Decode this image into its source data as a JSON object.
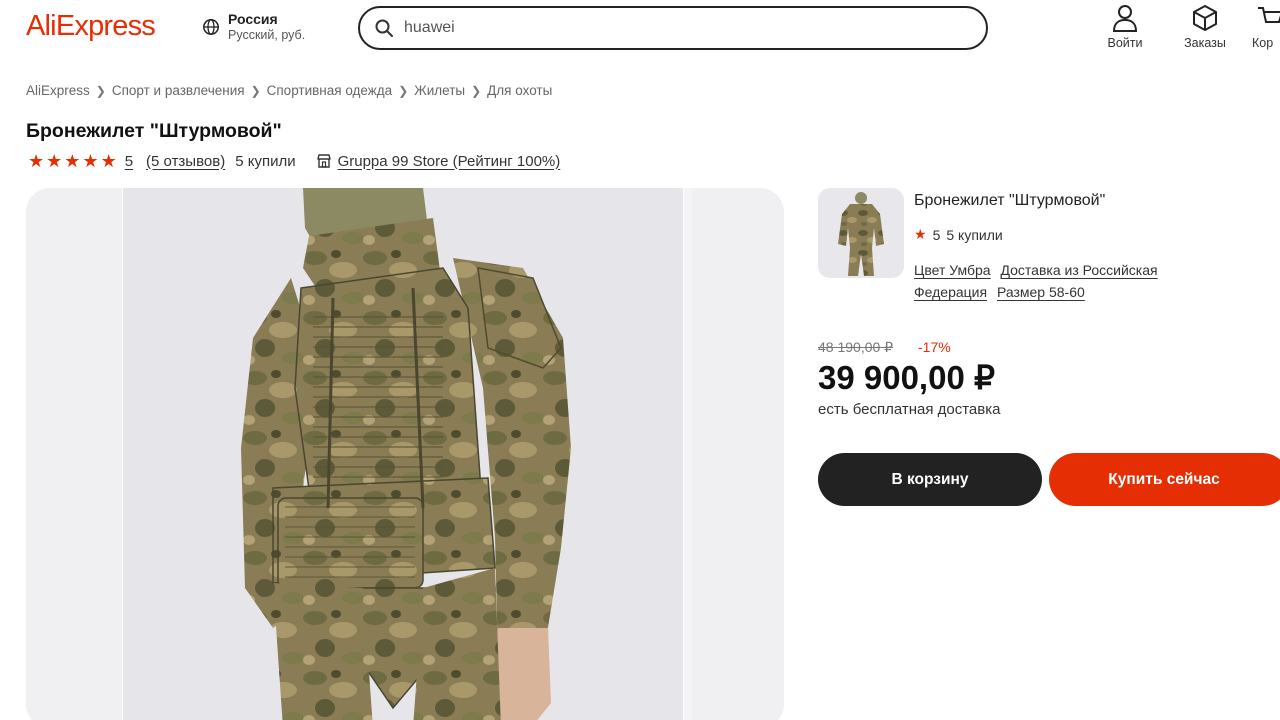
{
  "header": {
    "logo": "AliExpress",
    "region": {
      "country": "Россия",
      "lang_currency": "Русский, руб."
    },
    "search": {
      "value": "huawei",
      "placeholder": "huawei"
    },
    "actions": [
      {
        "label": "Войти",
        "icon": "user-icon"
      },
      {
        "label": "Заказы",
        "icon": "package-icon"
      },
      {
        "label": "Кор",
        "icon": "cart-icon"
      }
    ]
  },
  "breadcrumb": [
    "AliExpress",
    "Спорт и развлечения",
    "Спортивная одежда",
    "Жилеты",
    "Для охоты"
  ],
  "product": {
    "title": "Бронежилет \"Штурмовой\"",
    "rating": "5",
    "stars_filled": 5,
    "reviews": "(5 отзывов)",
    "sold": "5 купили",
    "store": "Gruppa 99 Store (Рейтинг 100%)"
  },
  "summary": {
    "title": "Бронежилет \"Штурмовой\"",
    "rating": "5",
    "sold": "5 купили",
    "props": [
      "Цвет Умбра",
      "Доставка из Российская Федерация",
      "Размер 58-60"
    ],
    "old_price": "48 190,00 ₽",
    "discount": "-17%",
    "price": "39 900,00 ₽",
    "shipping": "есть бесплатная доставка",
    "add_to_cart": "В корзину",
    "buy_now": "Купить сейчас"
  },
  "colors": {
    "brand": "#e62e04",
    "dark": "#222222"
  }
}
